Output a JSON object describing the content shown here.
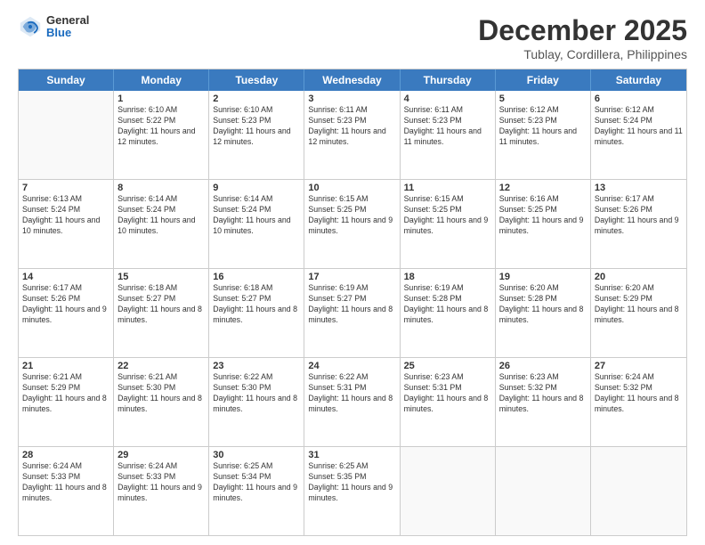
{
  "header": {
    "logo": {
      "general": "General",
      "blue": "Blue"
    },
    "title": "December 2025",
    "subtitle": "Tublay, Cordillera, Philippines"
  },
  "dayNames": [
    "Sunday",
    "Monday",
    "Tuesday",
    "Wednesday",
    "Thursday",
    "Friday",
    "Saturday"
  ],
  "weeks": [
    [
      {
        "date": "",
        "sunrise": "",
        "sunset": "",
        "daylight": "",
        "empty": true
      },
      {
        "date": "1",
        "sunrise": "Sunrise: 6:10 AM",
        "sunset": "Sunset: 5:22 PM",
        "daylight": "Daylight: 11 hours and 12 minutes."
      },
      {
        "date": "2",
        "sunrise": "Sunrise: 6:10 AM",
        "sunset": "Sunset: 5:23 PM",
        "daylight": "Daylight: 11 hours and 12 minutes."
      },
      {
        "date": "3",
        "sunrise": "Sunrise: 6:11 AM",
        "sunset": "Sunset: 5:23 PM",
        "daylight": "Daylight: 11 hours and 12 minutes."
      },
      {
        "date": "4",
        "sunrise": "Sunrise: 6:11 AM",
        "sunset": "Sunset: 5:23 PM",
        "daylight": "Daylight: 11 hours and 11 minutes."
      },
      {
        "date": "5",
        "sunrise": "Sunrise: 6:12 AM",
        "sunset": "Sunset: 5:23 PM",
        "daylight": "Daylight: 11 hours and 11 minutes."
      },
      {
        "date": "6",
        "sunrise": "Sunrise: 6:12 AM",
        "sunset": "Sunset: 5:24 PM",
        "daylight": "Daylight: 11 hours and 11 minutes."
      }
    ],
    [
      {
        "date": "7",
        "sunrise": "Sunrise: 6:13 AM",
        "sunset": "Sunset: 5:24 PM",
        "daylight": "Daylight: 11 hours and 10 minutes."
      },
      {
        "date": "8",
        "sunrise": "Sunrise: 6:14 AM",
        "sunset": "Sunset: 5:24 PM",
        "daylight": "Daylight: 11 hours and 10 minutes."
      },
      {
        "date": "9",
        "sunrise": "Sunrise: 6:14 AM",
        "sunset": "Sunset: 5:24 PM",
        "daylight": "Daylight: 11 hours and 10 minutes."
      },
      {
        "date": "10",
        "sunrise": "Sunrise: 6:15 AM",
        "sunset": "Sunset: 5:25 PM",
        "daylight": "Daylight: 11 hours and 9 minutes."
      },
      {
        "date": "11",
        "sunrise": "Sunrise: 6:15 AM",
        "sunset": "Sunset: 5:25 PM",
        "daylight": "Daylight: 11 hours and 9 minutes."
      },
      {
        "date": "12",
        "sunrise": "Sunrise: 6:16 AM",
        "sunset": "Sunset: 5:25 PM",
        "daylight": "Daylight: 11 hours and 9 minutes."
      },
      {
        "date": "13",
        "sunrise": "Sunrise: 6:17 AM",
        "sunset": "Sunset: 5:26 PM",
        "daylight": "Daylight: 11 hours and 9 minutes."
      }
    ],
    [
      {
        "date": "14",
        "sunrise": "Sunrise: 6:17 AM",
        "sunset": "Sunset: 5:26 PM",
        "daylight": "Daylight: 11 hours and 9 minutes."
      },
      {
        "date": "15",
        "sunrise": "Sunrise: 6:18 AM",
        "sunset": "Sunset: 5:27 PM",
        "daylight": "Daylight: 11 hours and 8 minutes."
      },
      {
        "date": "16",
        "sunrise": "Sunrise: 6:18 AM",
        "sunset": "Sunset: 5:27 PM",
        "daylight": "Daylight: 11 hours and 8 minutes."
      },
      {
        "date": "17",
        "sunrise": "Sunrise: 6:19 AM",
        "sunset": "Sunset: 5:27 PM",
        "daylight": "Daylight: 11 hours and 8 minutes."
      },
      {
        "date": "18",
        "sunrise": "Sunrise: 6:19 AM",
        "sunset": "Sunset: 5:28 PM",
        "daylight": "Daylight: 11 hours and 8 minutes."
      },
      {
        "date": "19",
        "sunrise": "Sunrise: 6:20 AM",
        "sunset": "Sunset: 5:28 PM",
        "daylight": "Daylight: 11 hours and 8 minutes."
      },
      {
        "date": "20",
        "sunrise": "Sunrise: 6:20 AM",
        "sunset": "Sunset: 5:29 PM",
        "daylight": "Daylight: 11 hours and 8 minutes."
      }
    ],
    [
      {
        "date": "21",
        "sunrise": "Sunrise: 6:21 AM",
        "sunset": "Sunset: 5:29 PM",
        "daylight": "Daylight: 11 hours and 8 minutes."
      },
      {
        "date": "22",
        "sunrise": "Sunrise: 6:21 AM",
        "sunset": "Sunset: 5:30 PM",
        "daylight": "Daylight: 11 hours and 8 minutes."
      },
      {
        "date": "23",
        "sunrise": "Sunrise: 6:22 AM",
        "sunset": "Sunset: 5:30 PM",
        "daylight": "Daylight: 11 hours and 8 minutes."
      },
      {
        "date": "24",
        "sunrise": "Sunrise: 6:22 AM",
        "sunset": "Sunset: 5:31 PM",
        "daylight": "Daylight: 11 hours and 8 minutes."
      },
      {
        "date": "25",
        "sunrise": "Sunrise: 6:23 AM",
        "sunset": "Sunset: 5:31 PM",
        "daylight": "Daylight: 11 hours and 8 minutes."
      },
      {
        "date": "26",
        "sunrise": "Sunrise: 6:23 AM",
        "sunset": "Sunset: 5:32 PM",
        "daylight": "Daylight: 11 hours and 8 minutes."
      },
      {
        "date": "27",
        "sunrise": "Sunrise: 6:24 AM",
        "sunset": "Sunset: 5:32 PM",
        "daylight": "Daylight: 11 hours and 8 minutes."
      }
    ],
    [
      {
        "date": "28",
        "sunrise": "Sunrise: 6:24 AM",
        "sunset": "Sunset: 5:33 PM",
        "daylight": "Daylight: 11 hours and 8 minutes."
      },
      {
        "date": "29",
        "sunrise": "Sunrise: 6:24 AM",
        "sunset": "Sunset: 5:33 PM",
        "daylight": "Daylight: 11 hours and 9 minutes."
      },
      {
        "date": "30",
        "sunrise": "Sunrise: 6:25 AM",
        "sunset": "Sunset: 5:34 PM",
        "daylight": "Daylight: 11 hours and 9 minutes."
      },
      {
        "date": "31",
        "sunrise": "Sunrise: 6:25 AM",
        "sunset": "Sunset: 5:35 PM",
        "daylight": "Daylight: 11 hours and 9 minutes."
      },
      {
        "date": "",
        "empty": true
      },
      {
        "date": "",
        "empty": true
      },
      {
        "date": "",
        "empty": true
      }
    ]
  ]
}
